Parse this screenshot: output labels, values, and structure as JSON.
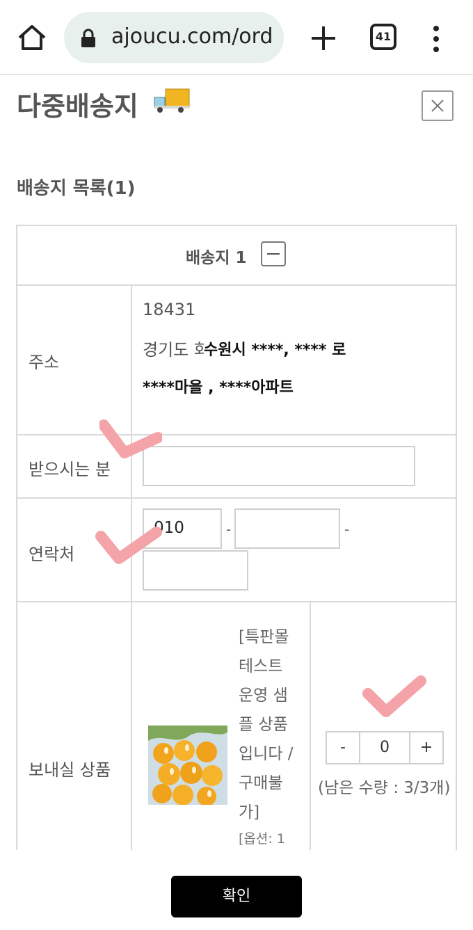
{
  "browser": {
    "url": "ajoucu.com/ord",
    "tab_count": "41"
  },
  "modal": {
    "title": "다중배송지",
    "list_title": "배송지 목록(1)",
    "destination_label": "배송지 1",
    "confirm_label": "확인"
  },
  "rows": {
    "address_label": "주소",
    "recipient_label": "받으시는 분",
    "contact_label": "연락처",
    "products_label": "보내실 상품"
  },
  "address": {
    "postcode": "18431",
    "line1_prefix": "경기도 화",
    "line1_bold": "수원시 ****, **** 로",
    "line2_bold": "****마을 , ****아파트"
  },
  "recipient": {
    "value": ""
  },
  "contact": {
    "part1": "010",
    "part2": "",
    "part3": "",
    "separator": "-"
  },
  "product": {
    "name": "[특판몰 테스트 운영 샘플 상품입니다 / 구매불가]",
    "option": "[옵션: 1",
    "quantity": "0",
    "minus_label": "-",
    "plus_label": "+",
    "remaining": "(남은 수량 : 3/3개)"
  },
  "icons": {
    "home": "home-icon",
    "lock": "lock-icon",
    "plus": "plus-icon",
    "tabs": "tabs-icon",
    "more": "more-icon",
    "truck": "truck-icon",
    "close": "close-icon",
    "check": "checkmark-icon"
  },
  "colors": {
    "check": "#f4a3a8",
    "confirm_bg": "#000000",
    "url_pill": "#e8f0ee"
  }
}
